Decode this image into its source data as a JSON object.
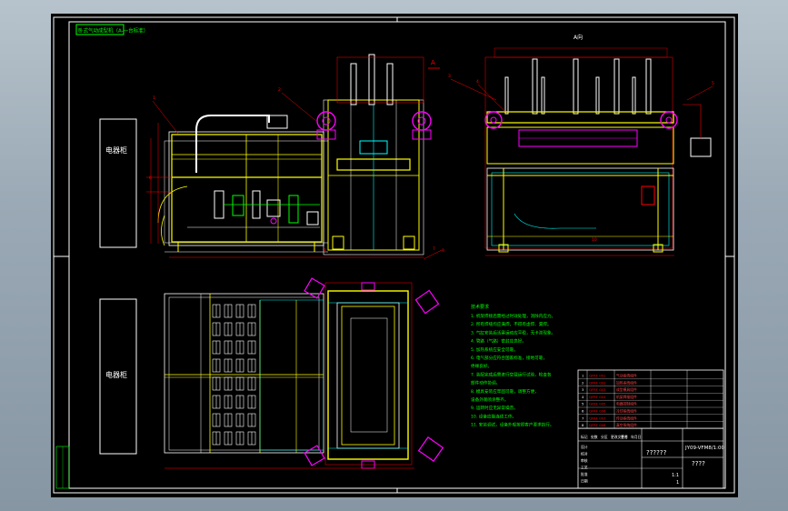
{
  "drawing": {
    "frame_title": "卧式气动成型机（A-一台标准）",
    "left_cabinet_top": "电器柜",
    "left_cabinet_bottom": "电器柜",
    "section_mark": "A",
    "view_label_right": "A向",
    "notes_heading": "技术要求",
    "notes": [
      "1.  机架焊接后需经过时效处理，消除内应力。",
      "2.  所有焊缝均应满焊，不得有虚焊、漏焊。",
      "3.  气缸安装后活塞运动应平稳，无卡滞现象。",
      "4.  管路（气路）密封应良好。",
      "5.  加热系统应安全可靠。",
      "6.  电气部分应符合国家标准，接地可靠，",
      "    绝缘良好。",
      "7.  装配完成后需进行空载运行试验，检查各",
      "    部件动作协调。",
      "8.  模具安装应牢固可靠，调整方便，",
      "    设备外观喷涂整齐。",
      "9.  运转时应无异常噪音。",
      "10. 设备应能连续工作。",
      "11. 安装调试，设备外观按照客户要求执行。"
    ],
    "callouts": [
      "1",
      "2",
      "3",
      "4",
      "5",
      "6",
      "7",
      "8",
      "9",
      "10"
    ],
    "title_block": {
      "drawing_no": "JY09-VFM8/1:00",
      "name": "??????",
      "sub": "????",
      "headers": [
        "标记",
        "处数",
        "分区",
        "更改文件号",
        "签名",
        "年月日"
      ],
      "rows": [
        [
          "1",
          "QFRF 001",
          "气动系统组件",
          ""
        ],
        [
          "2",
          "QFRF 002",
          "加热系统组件",
          ""
        ],
        [
          "3",
          "QFRF 003",
          "成型模具组件",
          ""
        ],
        [
          "4",
          "QFRF 004",
          "机架焊接组件",
          ""
        ],
        [
          "5",
          "QFRF 005",
          "电器控制组件",
          ""
        ],
        [
          "6",
          "QFRF 006",
          "冷却系统组件",
          ""
        ],
        [
          "7",
          "QFRF 007",
          "传动系统组件",
          ""
        ],
        [
          "8",
          "QFRF 008",
          "真空系统组件",
          ""
        ]
      ],
      "labels": [
        "设计",
        "校对",
        "审核",
        "工艺",
        "批准",
        "日期"
      ],
      "scale": "1:1",
      "sheet": "1"
    },
    "colors": {
      "frame": "#ffffff",
      "yellow": "#ffff00",
      "cyan": "#00ffff",
      "magenta": "#ff00ff",
      "red": "#ff0000",
      "green": "#00ff00",
      "blue": "#4466ff",
      "white": "#ffffff"
    }
  }
}
